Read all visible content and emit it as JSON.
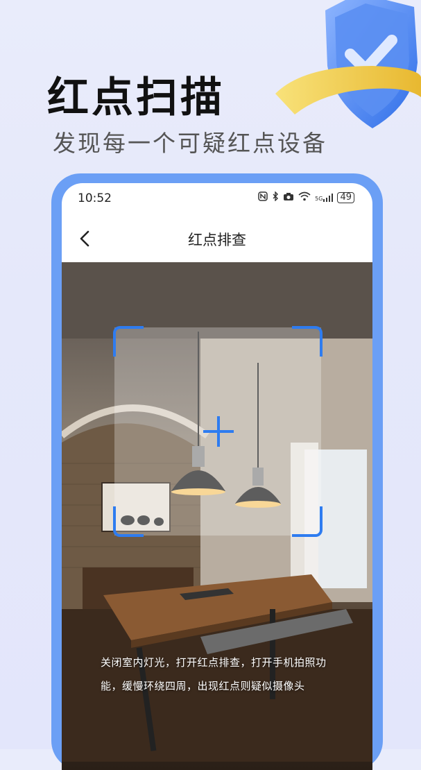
{
  "hero": {
    "title": "红点扫描",
    "subtitle": "发现每一个可疑红点设备"
  },
  "status_bar": {
    "time": "10:52",
    "icons": [
      "nfc-icon",
      "bluetooth-icon",
      "camera-icon",
      "wifi-icon",
      "signal-5g-icon"
    ],
    "signal_label": "5G",
    "battery": "49"
  },
  "nav": {
    "title": "红点排查"
  },
  "camera": {
    "hint": "关闭室内灯光，打开红点排查，打开手机拍照功能，缓慢环绕四周，出现红点则疑似摄像头"
  },
  "colors": {
    "accent": "#2e7cf0",
    "phone_frame": "#6b9ff5",
    "shield": "#3d7cf0",
    "ring": "#f3d25a"
  }
}
